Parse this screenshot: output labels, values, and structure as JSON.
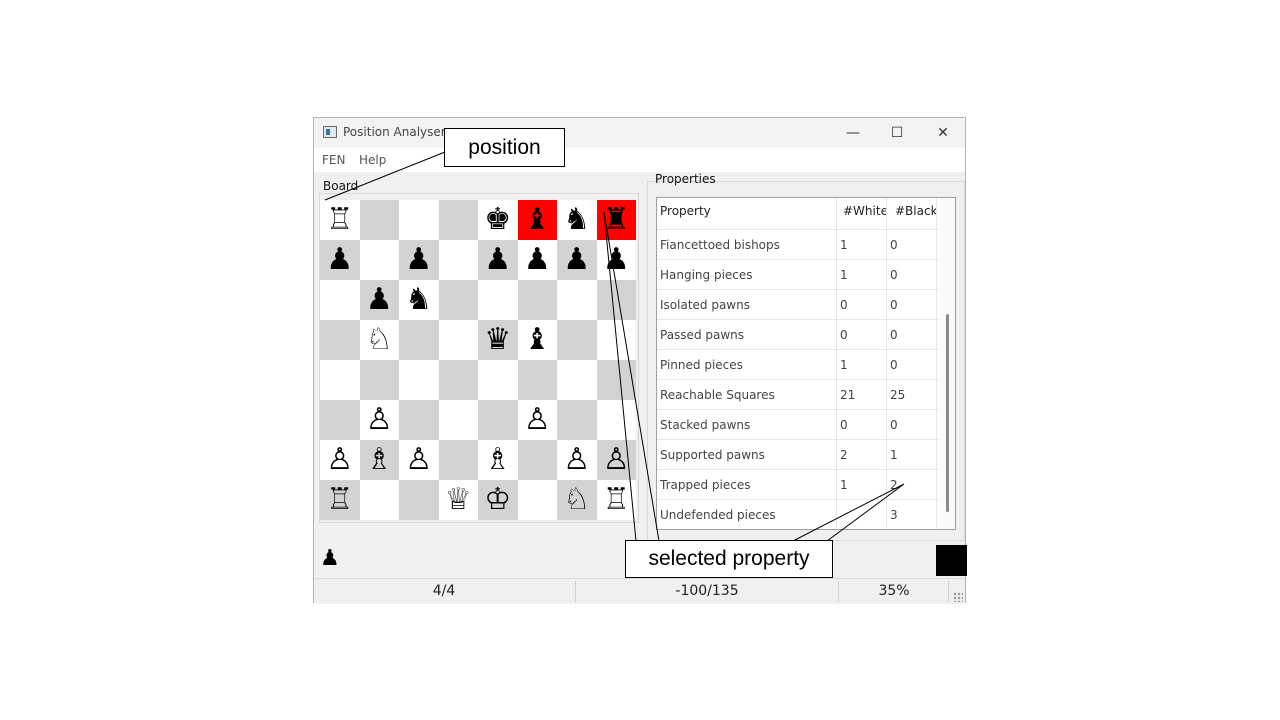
{
  "window": {
    "title": "Position Analyser",
    "controls": {
      "minimize": "—",
      "maximize": "☐",
      "close": "✕"
    }
  },
  "menu": [
    "FEN",
    "Help"
  ],
  "board": {
    "label": "Board",
    "light_color": "#ffffff",
    "dark_color": "#d3d3d3",
    "highlight_color": "#ff0000",
    "highlights": [
      [
        0,
        5
      ],
      [
        0,
        7
      ]
    ],
    "ranks": [
      [
        "♖",
        "",
        "",
        "",
        "♚",
        "♝",
        "♞",
        "♜"
      ],
      [
        "♟",
        "",
        "♟",
        "",
        "♟",
        "♟",
        "♟",
        "♟"
      ],
      [
        "",
        "♟",
        "♞",
        "",
        "",
        "",
        "",
        ""
      ],
      [
        "",
        "♘",
        "",
        "",
        "♛",
        "♝",
        "",
        ""
      ],
      [
        "",
        "",
        "",
        "",
        "",
        "",
        "",
        ""
      ],
      [
        "",
        "♙",
        "",
        "",
        "",
        "♙",
        "",
        ""
      ],
      [
        "♙",
        "♗",
        "♙",
        "",
        "♗",
        "",
        "♙",
        "♙"
      ],
      [
        "♖",
        "",
        "",
        "♕",
        "♔",
        "",
        "♘",
        "♖"
      ]
    ]
  },
  "properties": {
    "label": "Properties",
    "headers": [
      "Property",
      "#White",
      "#Black"
    ],
    "rows": [
      [
        "Fiancettoed bishops",
        "1",
        "0"
      ],
      [
        "Hanging pieces",
        "1",
        "0"
      ],
      [
        "Isolated pawns",
        "0",
        "0"
      ],
      [
        "Passed pawns",
        "0",
        "0"
      ],
      [
        "Pinned pieces",
        "1",
        "0"
      ],
      [
        "Reachable Squares",
        "21",
        "25"
      ],
      [
        "Stacked pawns",
        "0",
        "0"
      ],
      [
        "Supported pawns",
        "2",
        "1"
      ],
      [
        "Trapped pieces",
        "1",
        "2"
      ],
      [
        "Undefended pieces",
        "",
        "3"
      ]
    ]
  },
  "side_to_move": {
    "piece": "♟",
    "color": "#000000"
  },
  "status": {
    "move": "4/4",
    "score": "-100/135",
    "percent": "35%"
  },
  "callouts": {
    "position": "position",
    "selected_property": "selected property"
  }
}
